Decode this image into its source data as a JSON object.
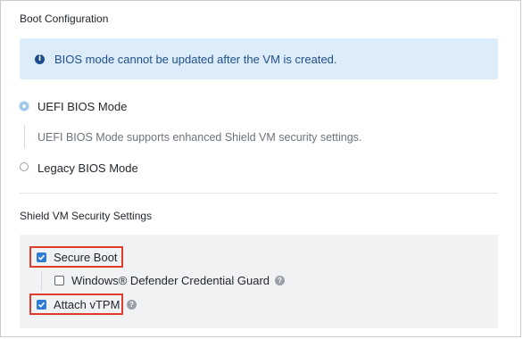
{
  "boot_config": {
    "title": "Boot Configuration",
    "info_banner": {
      "icon": "info-circle-icon",
      "text": "BIOS mode cannot be updated after the VM is created."
    },
    "uefi": {
      "label": "UEFI BIOS Mode",
      "selected": true,
      "description": "UEFI BIOS Mode supports enhanced Shield VM security settings."
    },
    "legacy": {
      "label": "Legacy BIOS Mode",
      "selected": false
    }
  },
  "shield": {
    "title": "Shield VM Security Settings",
    "secure_boot": {
      "label": "Secure Boot",
      "checked": true
    },
    "credential_guard": {
      "label": "Windows® Defender Credential Guard",
      "checked": false,
      "help_icon": "question-circle-icon"
    },
    "attach_vtpm": {
      "label": "Attach vTPM",
      "checked": true,
      "help_icon": "question-circle-icon"
    }
  },
  "colors": {
    "accent": "#2f7cd4",
    "highlight": "#e03c2d",
    "banner_bg": "#dcedf9",
    "banner_text": "#1f4e8a"
  }
}
